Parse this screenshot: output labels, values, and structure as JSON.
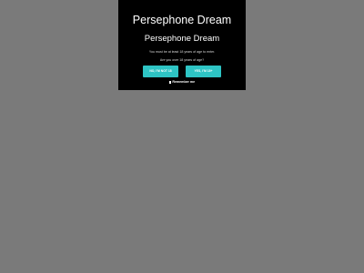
{
  "modal": {
    "site_title": "Persephone Dream",
    "heading": "Persephone Dream",
    "notice": "You must be at least 18 years of age to enter.",
    "question": "Are you over 18 years of age?",
    "no_button_label": "NO, I'M NOT 18",
    "yes_button_label": "YES, I'M 18+",
    "remember_label": "Remember me",
    "remember_checked": false
  },
  "colors": {
    "backdrop": "#7d7d7d",
    "modal_background": "#000000",
    "button_accent": "#2ec4c4",
    "text": "#ffffff"
  }
}
